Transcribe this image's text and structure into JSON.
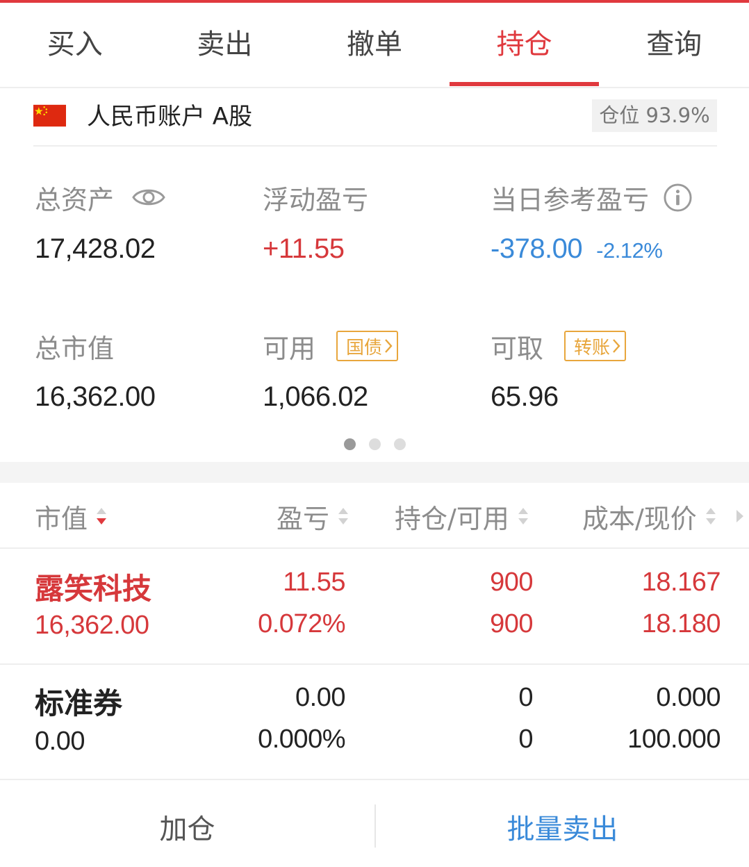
{
  "colors": {
    "accent_red": "#e0393e",
    "profit_red": "#d6383b",
    "loss_blue": "#3a8ad9",
    "label_gray": "#8c8c8c",
    "text_dark": "#222222",
    "badge_orange": "#e8a63c",
    "badge_bg": "#f1f1f1"
  },
  "tabs": [
    {
      "label": "买入",
      "active": false
    },
    {
      "label": "卖出",
      "active": false
    },
    {
      "label": "撤单",
      "active": false
    },
    {
      "label": "持仓",
      "active": true
    },
    {
      "label": "查询",
      "active": false
    }
  ],
  "account": {
    "flag_icon": "china-flag-icon",
    "name": "人民币账户 A股",
    "position_ratio": "仓位 93.9%"
  },
  "summary": {
    "total_assets": {
      "label": "总资产",
      "value": "17,428.02",
      "icon": "eye-icon"
    },
    "floating_pnl": {
      "label": "浮动盈亏",
      "value": "+11.55"
    },
    "daily_pnl": {
      "label": "当日参考盈亏",
      "value": "-378.00",
      "percent": "-2.12%",
      "icon": "info-icon"
    },
    "market_value": {
      "label": "总市值",
      "value": "16,362.00"
    },
    "available": {
      "label": "可用",
      "value": "1,066.02",
      "badge": "国债",
      "badge_icon": "chevron-right-icon"
    },
    "withdrawable": {
      "label": "可取",
      "value": "65.96",
      "badge": "转账",
      "badge_icon": "chevron-right-icon"
    }
  },
  "pager": {
    "pages": 3,
    "current": 1
  },
  "table": {
    "headers": [
      {
        "label": "市值",
        "sort_icon": "sort-desc-icon"
      },
      {
        "label": "盈亏",
        "sort_icon": "sort-icon"
      },
      {
        "label": "持仓/可用",
        "sort_icon": "sort-icon"
      },
      {
        "label": "成本/现价",
        "sort_icon": "sort-icon"
      }
    ],
    "more_icon": "chevron-right-icon",
    "rows": [
      {
        "name": "露笑科技",
        "market_value": "16,362.00",
        "pnl": "11.55",
        "pnl_percent": "0.072%",
        "position": "900",
        "available": "900",
        "cost": "18.167",
        "price": "18.180",
        "color": "#d6383b"
      },
      {
        "name": "标准券",
        "market_value": "0.00",
        "pnl": "0.00",
        "pnl_percent": "0.000%",
        "position": "0",
        "available": "0",
        "cost": "0.000",
        "price": "100.000",
        "color": "#222222"
      }
    ]
  },
  "actions": {
    "add_position": "加仓",
    "batch_sell": "批量卖出"
  }
}
